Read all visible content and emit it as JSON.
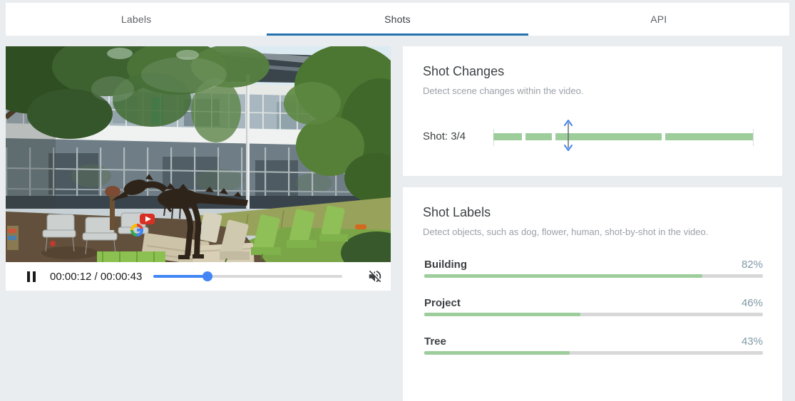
{
  "tabs": [
    {
      "label": "Labels",
      "active": false
    },
    {
      "label": "Shots",
      "active": true
    },
    {
      "label": "API",
      "active": false
    }
  ],
  "video_player": {
    "time_display": "00:00:12 / 00:00:43",
    "progress_pct": 28.7,
    "muted": true,
    "scene_description": "Campus courtyard: glass office building, T-rex skeleton sculpture, trees, green lawn chairs"
  },
  "shot_changes": {
    "title": "Shot Changes",
    "subtitle": "Detect scene changes within the video.",
    "current_shot": "Shot: 3/4",
    "marker_left_pct": 28.8,
    "segments": [
      {
        "left_pct": 0,
        "width_pct": 11.0
      },
      {
        "left_pct": 12.3,
        "width_pct": 10.2
      },
      {
        "left_pct": 23.7,
        "width_pct": 41.0
      },
      {
        "left_pct": 66.1,
        "width_pct": 33.6
      }
    ]
  },
  "shot_labels": {
    "title": "Shot Labels",
    "subtitle": "Detect objects, such as dog, flower, human, shot-by-shot in the video.",
    "items": [
      {
        "label": "Building",
        "pct_text": "82%",
        "value": 82
      },
      {
        "label": "Project",
        "pct_text": "46%",
        "value": 46
      },
      {
        "label": "Tree",
        "pct_text": "43%",
        "value": 43
      }
    ]
  },
  "icons": {
    "pause": "pause-icon",
    "mute": "volume-muted-icon",
    "marker": "shot-marker-chevrons-icon"
  },
  "colors": {
    "accent_blue": "#4285f4",
    "tab_underline": "#2473ae",
    "segment_green": "#9ccd9b",
    "track_gray": "#d8d8d8",
    "pct_text": "#7f9aa6"
  }
}
